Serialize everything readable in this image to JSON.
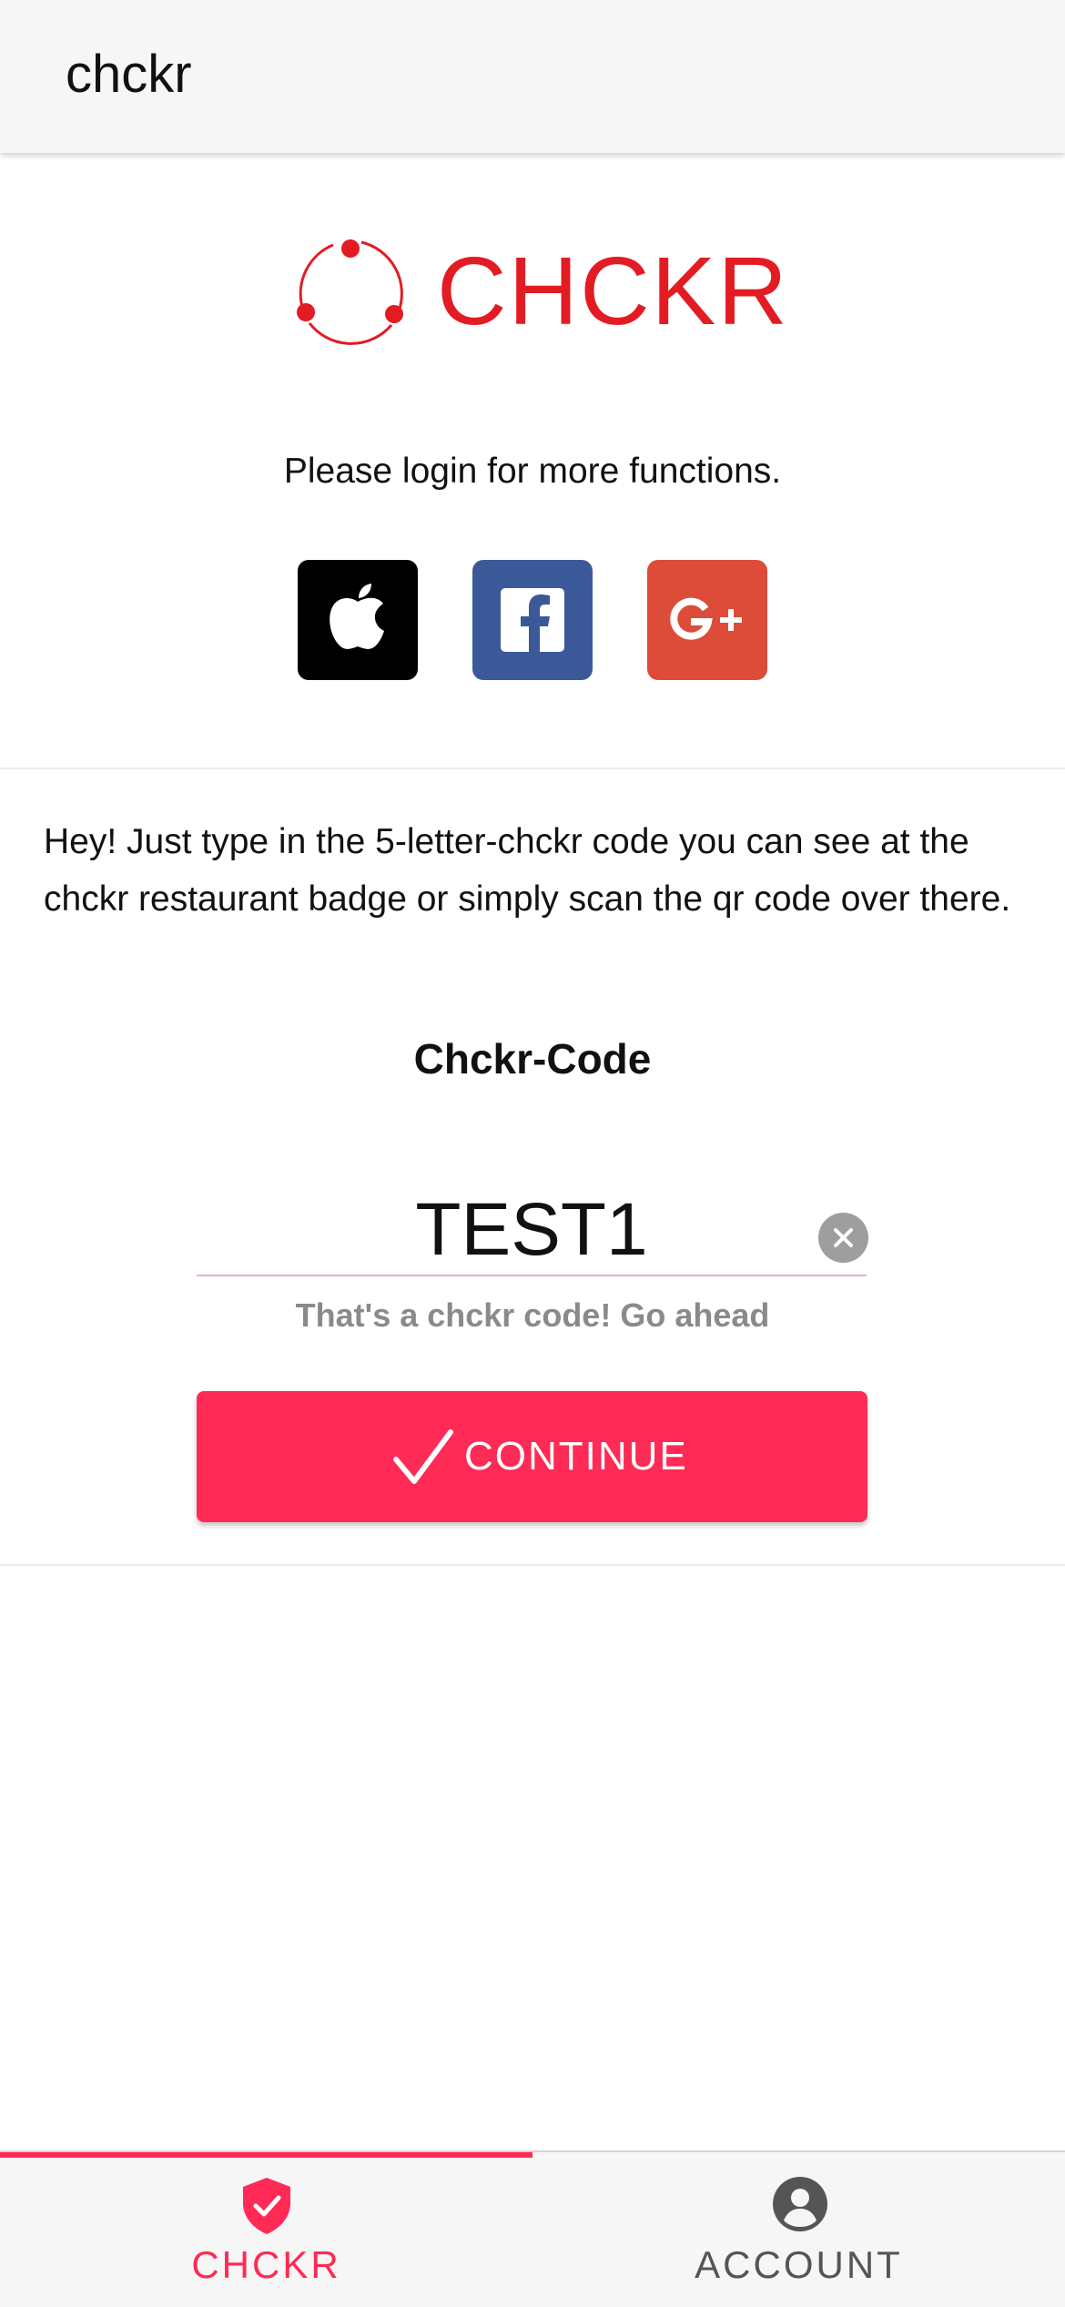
{
  "header": {
    "title": "chckr"
  },
  "logo": {
    "text": "CHCKR"
  },
  "login": {
    "prompt": "Please login for more functions.",
    "providers": [
      "apple-icon",
      "facebook-icon",
      "google-plus-icon"
    ]
  },
  "instructions": "Hey! Just type in the 5-letter-chckr code you can see at the chckr restaurant badge or simply scan the qr code over there.",
  "code": {
    "heading": "Chckr-Code",
    "value": "TEST1",
    "hint": "That's a chckr code! Go ahead"
  },
  "continue_button": {
    "label": "CONTINUE"
  },
  "tabs": [
    {
      "label": "CHCKR",
      "icon": "shield-check-icon",
      "active": true
    },
    {
      "label": "ACCOUNT",
      "icon": "account-circle-icon",
      "active": false
    }
  ],
  "colors": {
    "brand_red": "#e31b23",
    "accent": "#ff2a55",
    "facebook": "#3b5998",
    "google": "#dd4b39",
    "apple": "#000000"
  }
}
